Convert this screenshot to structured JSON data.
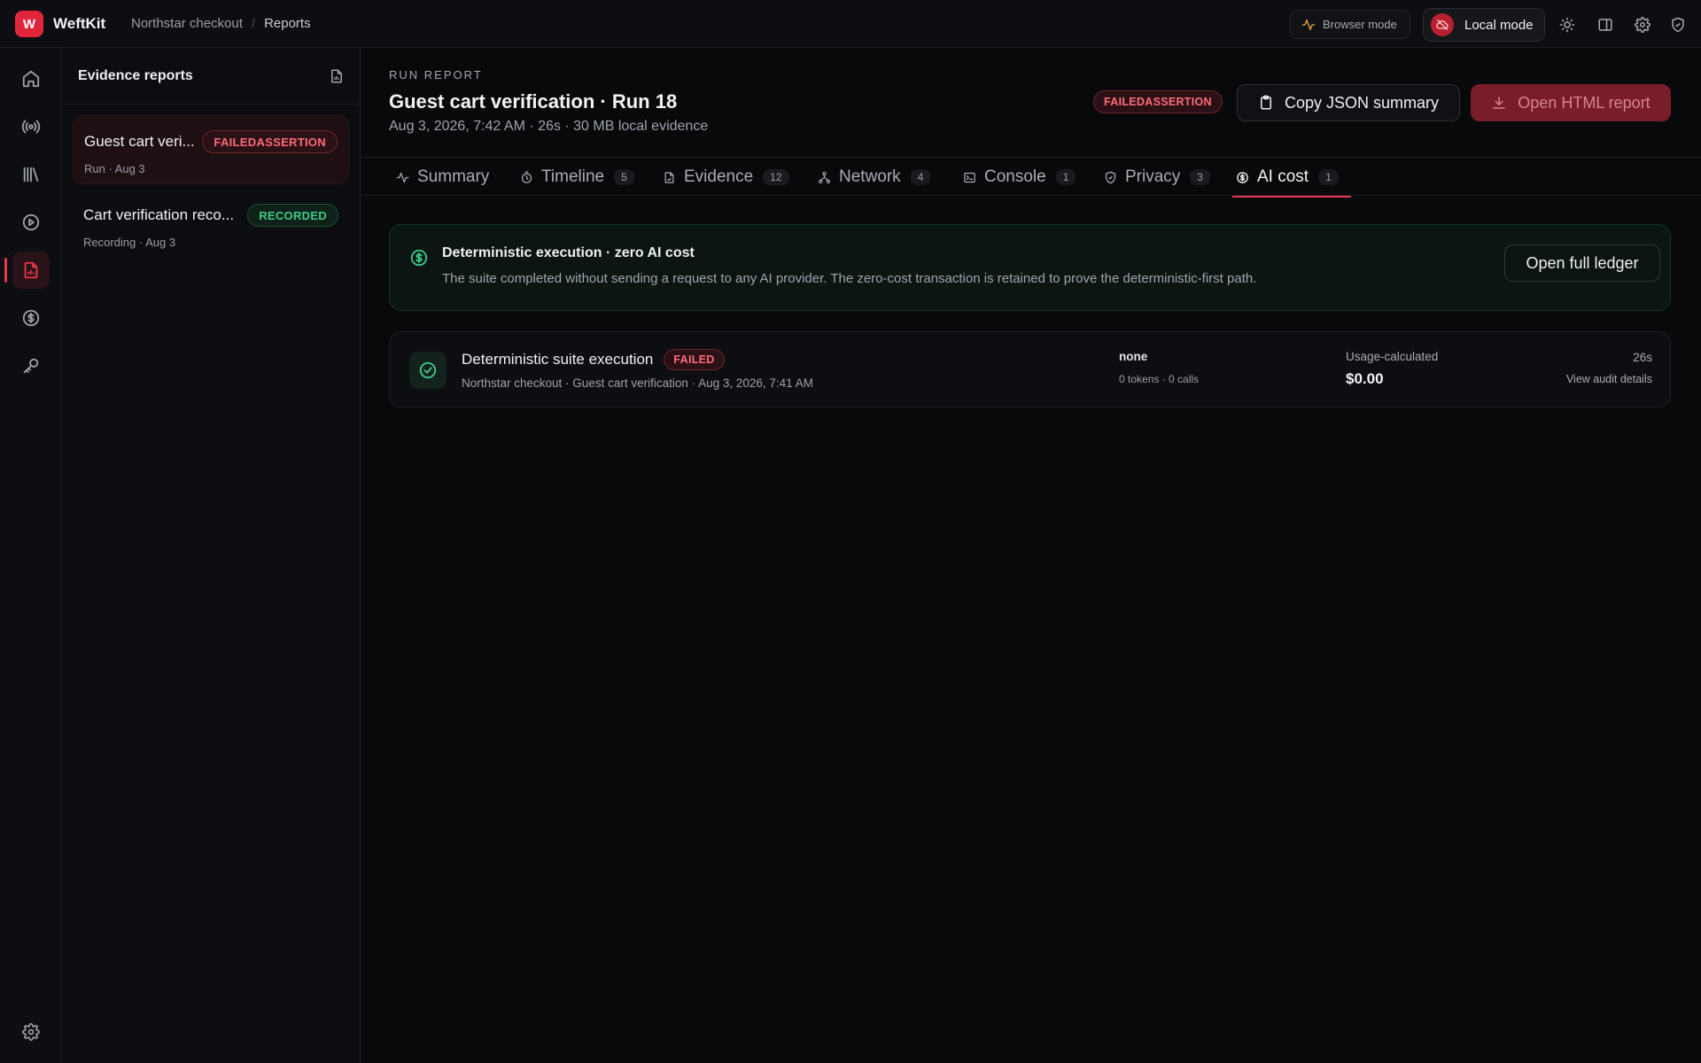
{
  "app": {
    "brand_initial": "W",
    "brand_name": "WeftKit",
    "breadcrumbs": [
      "Northstar checkout",
      "Reports"
    ],
    "browser_mode_label": "Browser mode",
    "local_mode_label": "Local mode",
    "accent_color": "#e8384d",
    "success_color": "#3ecb88"
  },
  "rail": {
    "items": [
      "home-icon",
      "broadcast-icon",
      "library-icon",
      "play-icon",
      "report-icon",
      "dollar-icon",
      "key-icon"
    ],
    "active": "report-icon",
    "bottom": "gear-icon"
  },
  "reports_panel": {
    "title": "Evidence reports",
    "items": [
      {
        "name": "Guest cart veri...",
        "badge": "FAILEDASSERTION",
        "sub": "Run · Aug 3"
      },
      {
        "name": "Cart verification reco...",
        "badge": "RECORDED",
        "sub": "Recording · Aug 3"
      }
    ]
  },
  "report": {
    "kicker": "RUN REPORT",
    "title": "Guest cart verification · Run 18",
    "meta": "Aug 3, 2026, 7:42 AM · 26s · 30 MB local evidence",
    "status_badge": "FAILEDASSERTION",
    "copy_label": "Copy JSON summary",
    "open_label": "Open HTML report"
  },
  "tabs": [
    {
      "label": "Summary",
      "count": ""
    },
    {
      "label": "Timeline",
      "count": "5"
    },
    {
      "label": "Evidence",
      "count": "12"
    },
    {
      "label": "Network",
      "count": "4"
    },
    {
      "label": "Console",
      "count": "1"
    },
    {
      "label": "Privacy",
      "count": "3"
    },
    {
      "label": "AI cost",
      "count": "1"
    }
  ],
  "active_tab": "AI cost",
  "notice": {
    "title": "Deterministic execution · zero AI cost",
    "text": "The suite completed without sending a request to any AI provider. The zero-cost transaction is retained to prove the deterministic-first path.",
    "button": "Open full ledger"
  },
  "transaction": {
    "title": "Deterministic suite execution",
    "badge": "FAILED",
    "sub": "Northstar checkout · Guest cart verification · Aug 3, 2026, 7:41 AM",
    "provider": "none",
    "usage": "0 tokens · 0 calls",
    "method": "Usage-calculated",
    "amount": "$0.00",
    "duration": "26s",
    "link": "View audit details"
  }
}
